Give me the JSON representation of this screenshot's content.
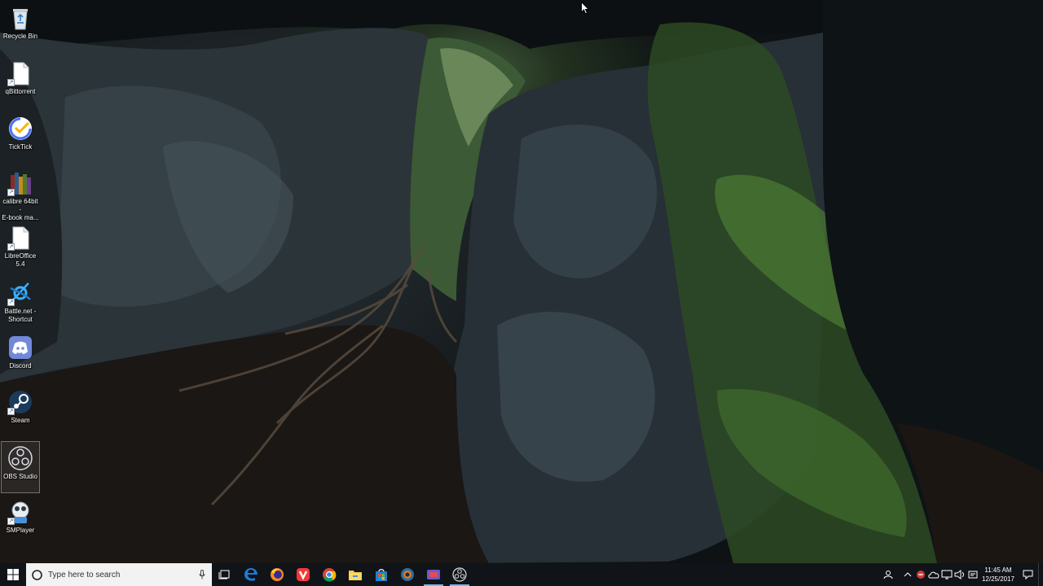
{
  "desktop": {
    "icons": [
      {
        "label": "Recycle Bin",
        "icon": "recycle-bin-icon"
      },
      {
        "label": "qBittorrent",
        "icon": "qbittorrent-icon"
      },
      {
        "label": "TickTick",
        "icon": "ticktick-icon"
      },
      {
        "label": "calibre 64bit -\nE-book ma...",
        "icon": "calibre-icon"
      },
      {
        "label": "LibreOffice\n5.4",
        "icon": "libreoffice-icon"
      },
      {
        "label": "Battle.net -\nShortcut",
        "icon": "battlenet-icon"
      },
      {
        "label": "Discord",
        "icon": "discord-icon"
      },
      {
        "label": "Steam",
        "icon": "steam-icon"
      },
      {
        "label": "OBS Studio",
        "icon": "obs-icon"
      },
      {
        "label": "SMPlayer",
        "icon": "smplayer-icon"
      }
    ]
  },
  "taskbar": {
    "search_placeholder": "Type here to search",
    "pinned": [
      {
        "name": "task-view",
        "icon": "task-view-icon",
        "running": false
      },
      {
        "name": "edge",
        "icon": "edge-icon",
        "running": false
      },
      {
        "name": "firefox",
        "icon": "firefox-icon",
        "running": false
      },
      {
        "name": "vivaldi",
        "icon": "vivaldi-icon",
        "running": false
      },
      {
        "name": "chrome",
        "icon": "chrome-icon",
        "running": false
      },
      {
        "name": "file-explorer",
        "icon": "folder-icon",
        "running": false
      },
      {
        "name": "store",
        "icon": "store-icon",
        "running": false
      },
      {
        "name": "app-7",
        "icon": "app-icon",
        "running": false
      },
      {
        "name": "app-8",
        "icon": "app-icon",
        "running": true
      },
      {
        "name": "obs-studio",
        "icon": "obs-icon",
        "running": true
      }
    ],
    "clock": {
      "time": "11:45 AM",
      "date": "12/25/2017"
    }
  },
  "colors": {
    "taskbar_bg": "#101418",
    "accent": "#76b9ed"
  }
}
